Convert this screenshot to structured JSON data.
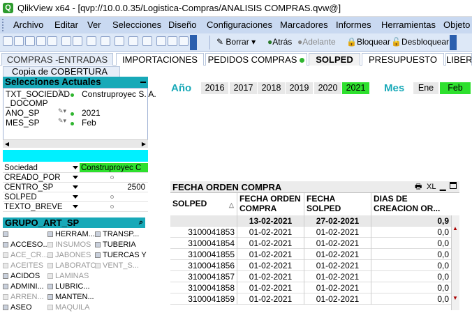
{
  "window": {
    "title": "QlikView x64 - [qvp://10.0.0.35/Logistica-Compras/ANALISIS COMPRAS.qvw@]"
  },
  "menu": [
    "Archivo",
    "Editar",
    "Ver",
    "Selecciones",
    "Diseño",
    "Configuraciones",
    "Marcadores",
    "Informes",
    "Herramientas",
    "Objeto"
  ],
  "toolbar": {
    "clear": "Borrar",
    "back": "Atrás",
    "forward": "Adelante",
    "lock": "Bloquear",
    "unlock": "Desbloquear"
  },
  "tabs": [
    "COMPRAS -ENTRADAS",
    "IMPORTACIONES",
    "PEDIDOS COMPRAS",
    "SOLPED",
    "PRESUPUESTO",
    "LIBER"
  ],
  "copia": "Copia de COBERTURA",
  "current_selections": {
    "title": "Selecciones Actuales",
    "rows": [
      {
        "field": "TXT_SOCIEDAD",
        "field2": "_DOCOMP",
        "value": "Construproyec S. A."
      },
      {
        "field": "ANO_SP",
        "value": "2021"
      },
      {
        "field": "MES_SP",
        "value": "Feb"
      }
    ]
  },
  "listboxes": [
    {
      "label": "Sociedad",
      "value": "Construproyec C",
      "selected": true
    },
    {
      "label": "CREADO_POR",
      "value": "",
      "selected": false
    },
    {
      "label": "CENTRO_SP",
      "value": "2500",
      "selected": false
    },
    {
      "label": "SOLPED",
      "value": "",
      "selected": false
    },
    {
      "label": "TEXTO_BREVE",
      "value": "",
      "selected": false
    }
  ],
  "grupo": {
    "title": "GRUPO_ART_SP",
    "col1": [
      "",
      "ACCESO...",
      "ACE_CR...",
      "ACEITES",
      "ACIDOS",
      "ADMINI...",
      "ARREN...",
      "ASEO"
    ],
    "col2": [
      "HERRAM...",
      "INSUMOS",
      "JABONES",
      "LABORATO",
      "LAMINAS",
      "LUBRIC...",
      "MANTEN...",
      "MAQUILA"
    ],
    "col3": [
      "TRANSP...",
      "TUBERIA",
      "TUERCAS Y",
      "VENT_S..."
    ],
    "col1_excluded": [
      false,
      false,
      true,
      true,
      false,
      false,
      true,
      false
    ],
    "col2_excluded": [
      false,
      true,
      true,
      true,
      true,
      false,
      false,
      true
    ],
    "col3_excluded": [
      false,
      false,
      false,
      true
    ]
  },
  "year": {
    "label": "Año",
    "values": [
      "2016",
      "2017",
      "2018",
      "2019",
      "2020",
      "2021"
    ],
    "selected": "2021"
  },
  "month": {
    "label": "Mes",
    "values": [
      "Ene",
      "Feb"
    ],
    "selected": "Feb"
  },
  "table": {
    "title": "FECHA ORDEN COMPRA",
    "xl": "XL",
    "columns": [
      "SOLPED",
      "FECHA ORDEN COMPRA",
      "FECHA SOLPED",
      "DIAS DE CREACION OR..."
    ],
    "totals": [
      "",
      "13-02-2021",
      "27-02-2021",
      "0,9"
    ],
    "rows": [
      [
        "3100041853",
        "01-02-2021",
        "01-02-2021",
        "0,0"
      ],
      [
        "3100041854",
        "01-02-2021",
        "01-02-2021",
        "0,0"
      ],
      [
        "3100041855",
        "01-02-2021",
        "01-02-2021",
        "0,0"
      ],
      [
        "3100041856",
        "01-02-2021",
        "01-02-2021",
        "0,0"
      ],
      [
        "3100041857",
        "01-02-2021",
        "01-02-2021",
        "0,0"
      ],
      [
        "3100041858",
        "01-02-2021",
        "01-02-2021",
        "0,0"
      ],
      [
        "3100041859",
        "01-02-2021",
        "01-02-2021",
        "0,0"
      ]
    ]
  }
}
